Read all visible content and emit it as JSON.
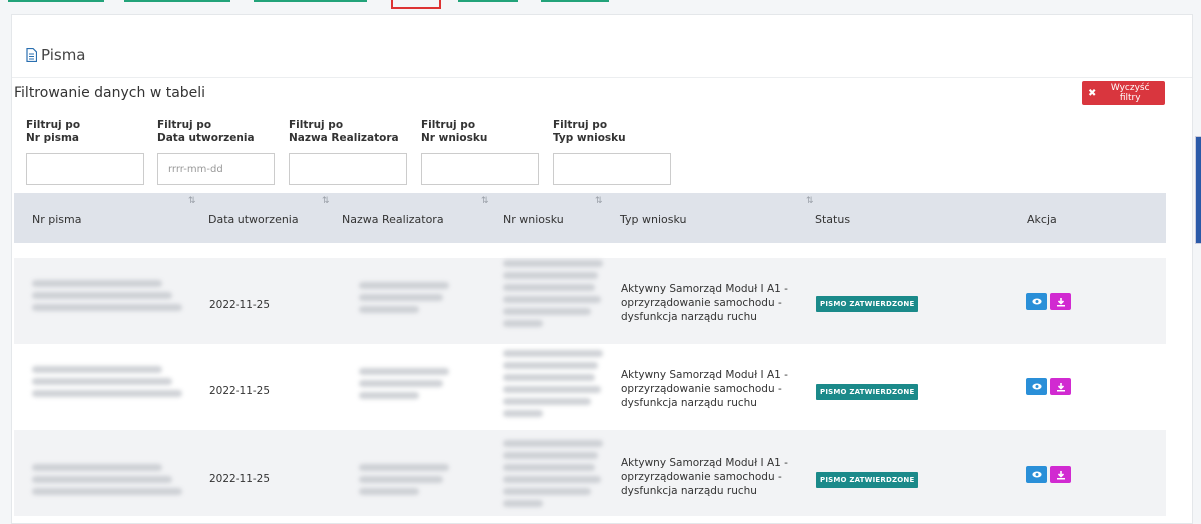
{
  "card": {
    "title": "Pisma"
  },
  "filters": {
    "heading": "Filtrowanie danych w tabeli",
    "clear_label": "Wyczyść filtry",
    "groups": [
      {
        "line1": "Filtruj po",
        "line2": "Nr pisma",
        "placeholder": ""
      },
      {
        "line1": "Filtruj po",
        "line2": "Data utworzenia",
        "placeholder": "rrrr-mm-dd"
      },
      {
        "line1": "Filtruj po",
        "line2": "Nazwa Realizatora",
        "placeholder": ""
      },
      {
        "line1": "Filtruj po",
        "line2": "Nr wniosku",
        "placeholder": ""
      },
      {
        "line1": "Filtruj po",
        "line2": "Typ wniosku",
        "placeholder": ""
      }
    ]
  },
  "table": {
    "columns": [
      "Nr pisma",
      "Data utworzenia",
      "Nazwa Realizatora",
      "Nr wniosku",
      "Typ wniosku",
      "Status",
      "Akcja"
    ],
    "rows": [
      {
        "date": "2022-11-25",
        "typ1": "Aktywny Samorząd Moduł I A1 -",
        "typ2": "oprzyrządowanie samochodu -",
        "typ3": "dysfunkcja narządu ruchu",
        "status": "PISMO ZATWIERDZONE"
      },
      {
        "date": "2022-11-25",
        "typ1": "Aktywny Samorząd Moduł I A1 -",
        "typ2": "oprzyrządowanie samochodu -",
        "typ3": "dysfunkcja narządu ruchu",
        "status": "PISMO ZATWIERDZONE"
      },
      {
        "date": "2022-11-25",
        "typ1": "Aktywny Samorząd Moduł I A1 -",
        "typ2": "oprzyrządowanie samochodu -",
        "typ3": "dysfunkcja narządu ruchu",
        "status": "PISMO ZATWIERDZONE"
      }
    ]
  },
  "icons": {
    "document": "document-icon",
    "sort": "sort-icon",
    "clear": "close-icon",
    "view": "eye-icon",
    "download": "download-icon"
  },
  "colors": {
    "clear_button": "#d9363e",
    "status_badge": "#1b8a8a",
    "view_button": "#2a8fd8",
    "download_button": "#d12ad1",
    "table_header": "#dfe3ea"
  }
}
